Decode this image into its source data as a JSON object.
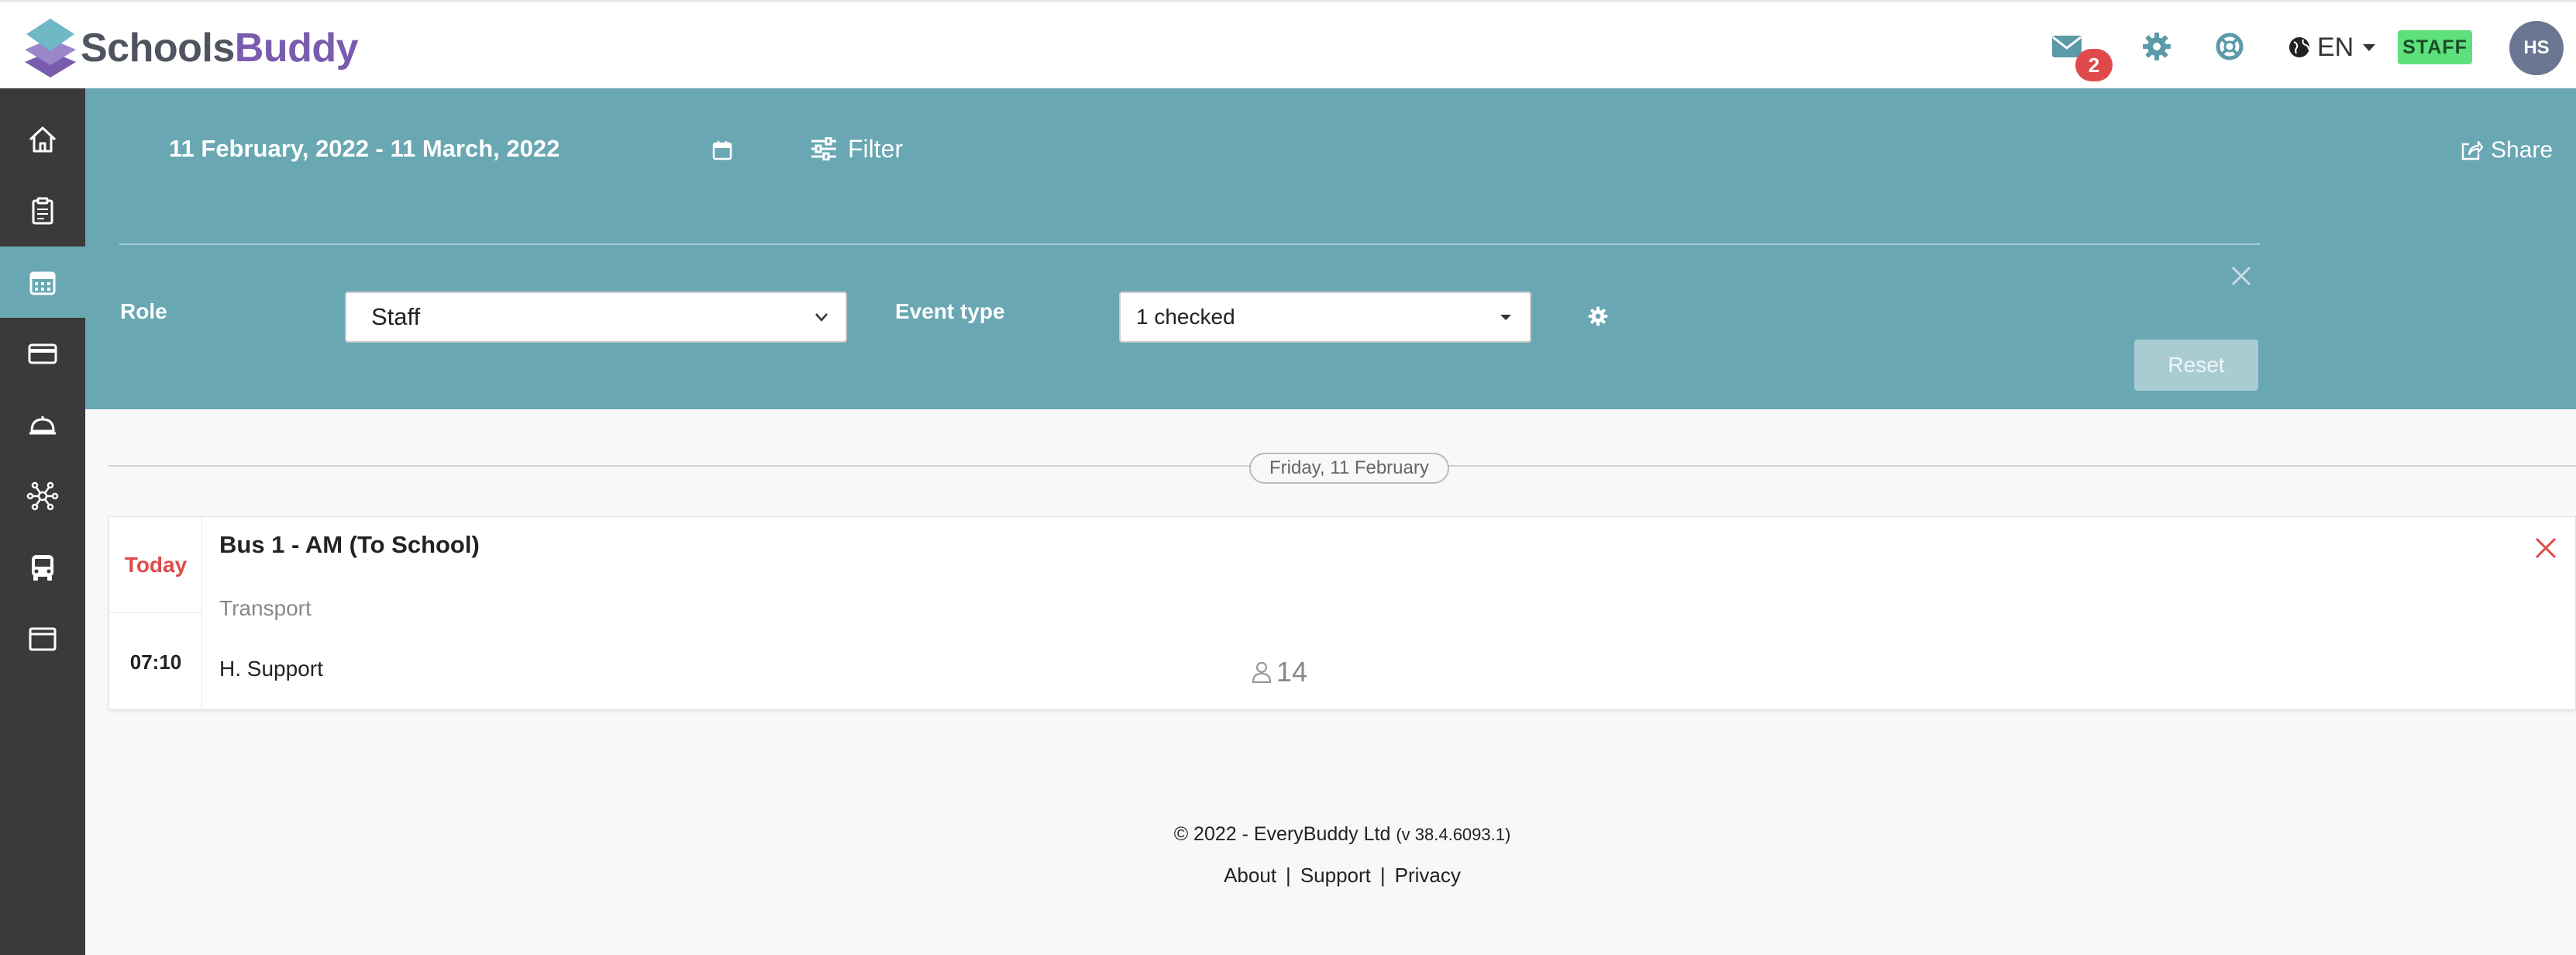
{
  "brand": {
    "name_part1": "Schools",
    "name_part2": "Buddy"
  },
  "topbar": {
    "messages_count": "2",
    "language": "EN",
    "role_badge": "STAFF",
    "user_initials": "HS"
  },
  "sidebar": {
    "items": [
      {
        "icon": "home-icon"
      },
      {
        "icon": "clipboard-icon"
      },
      {
        "icon": "calendar-icon",
        "active": true
      },
      {
        "icon": "credit-card-icon"
      },
      {
        "icon": "service-bell-icon"
      },
      {
        "icon": "network-icon"
      },
      {
        "icon": "bus-icon"
      },
      {
        "icon": "window-icon"
      }
    ]
  },
  "filters": {
    "date_range": "11 February, 2022 - 11 March, 2022",
    "filter_label": "Filter",
    "share_label": "Share",
    "role_label": "Role",
    "role_value": "Staff",
    "event_type_label": "Event type",
    "event_type_value": "1 checked",
    "reset_label": "Reset"
  },
  "events": {
    "day_label": "Friday, 11 February",
    "items": [
      {
        "day_tag": "Today",
        "time": "07:10",
        "title": "Bus 1 - AM (To School)",
        "category": "Transport",
        "organiser": "H. Support",
        "attendees": "14"
      }
    ]
  },
  "footer": {
    "copyright": "© 2022 - EveryBuddy Ltd",
    "version": "(v 38.4.6093.1)",
    "links": [
      "About",
      "Support",
      "Privacy"
    ]
  },
  "colors": {
    "accent": "#69a7b3",
    "sidebar": "#3a3a3a",
    "brand_purple": "#7a5cae",
    "alert_red": "#e04a4a",
    "staff_green": "#5ee07c"
  }
}
